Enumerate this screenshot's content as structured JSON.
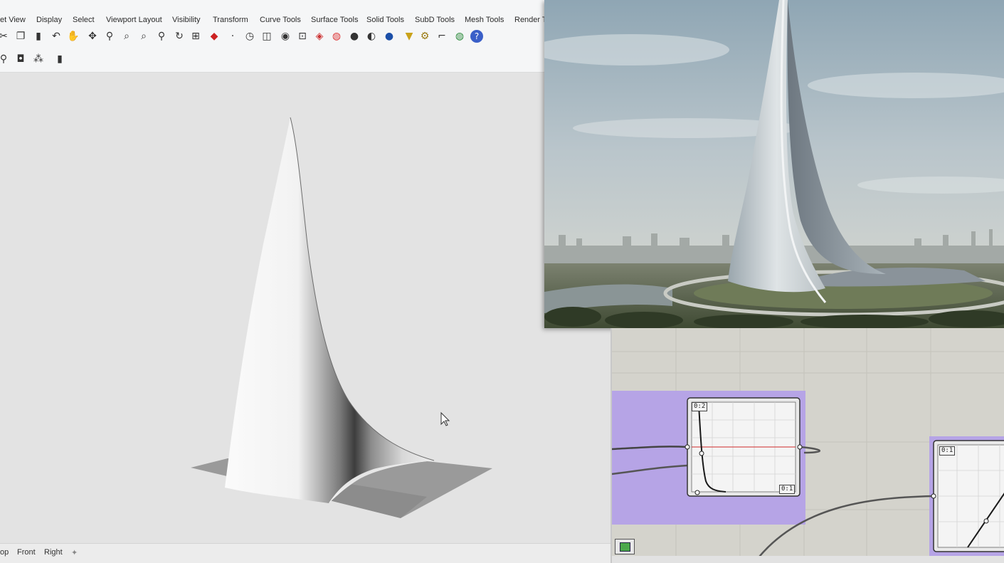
{
  "menu": {
    "tabs": [
      "et View",
      "Display",
      "Select",
      "Viewport Layout",
      "Visibility",
      "Transform",
      "Curve Tools",
      "Surface Tools",
      "Solid Tools",
      "SubD Tools",
      "Mesh Tools",
      "Render To"
    ]
  },
  "toolbar": {
    "row1_icons": [
      "cut-icon",
      "copy-icon",
      "paste-icon",
      "undo-icon",
      "pan-hand-icon",
      "move-view-icon",
      "zoom-icon",
      "zoom-window-icon",
      "zoom-extents-icon",
      "zoom-selected-icon",
      "rotate-view-icon",
      "grid-icon",
      "car-icon",
      "point-icon",
      "clock-icon",
      "layer-icon",
      "lightbulb-icon",
      "lock-icon",
      "material-icon",
      "color-wheel-icon",
      "shaded-sphere-icon",
      "rendered-sphere-icon",
      "blue-sphere-icon",
      "filter-icon",
      "gear-icon",
      "snap-icon",
      "globe-icon",
      "help-icon"
    ],
    "row2_icons": [
      "properties-icon",
      "display-icon",
      "objects-icon",
      "analysis-icon"
    ]
  },
  "viewport_tabs": [
    "op",
    "Front",
    "Right"
  ],
  "colors": {
    "gh_canvas": "#d4d3cc",
    "gh_group": "#b6a4e6",
    "graph_curve": "#1a1a1a",
    "graph_line_red": "#d12a2a"
  },
  "gh": {
    "graph1": {
      "badge_top": "0:2",
      "badge_bottom": "0:1"
    },
    "graph2": {
      "badge_top": "0:1"
    }
  }
}
